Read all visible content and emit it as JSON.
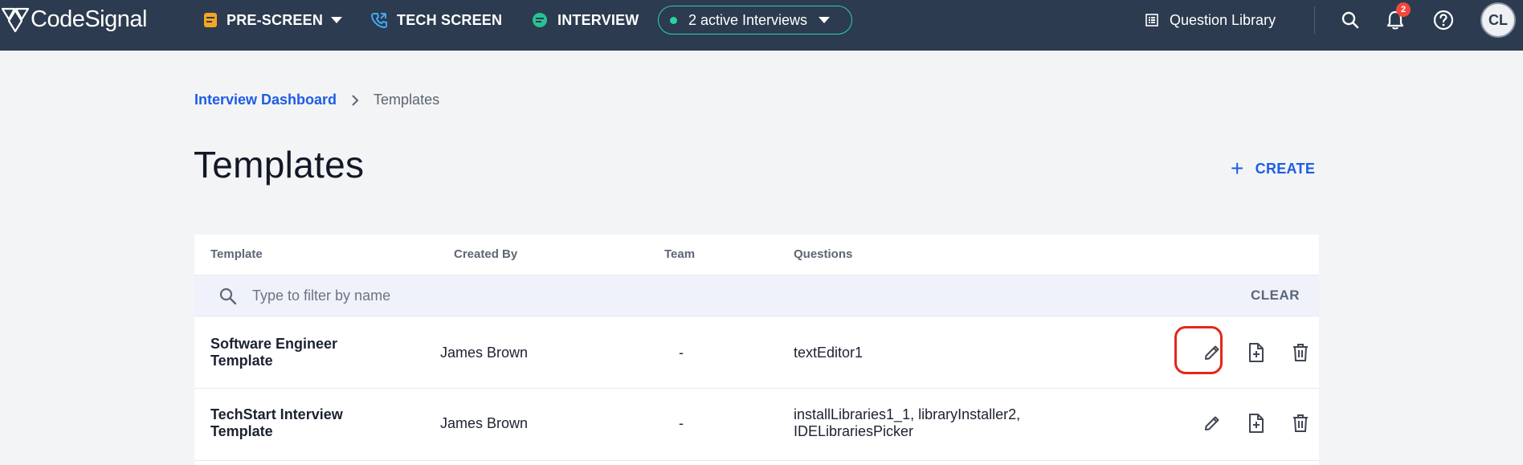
{
  "app": {
    "brand": "CodeSignal"
  },
  "nav": {
    "pre_screen": "PRE-SCREEN",
    "tech_screen": "TECH SCREEN",
    "interview": "INTERVIEW",
    "active_interviews": "2 active Interviews",
    "question_library": "Question Library",
    "notifications_count": "2",
    "avatar_initials": "CL"
  },
  "breadcrumb": {
    "parent": "Interview Dashboard",
    "current": "Templates"
  },
  "page": {
    "title": "Templates",
    "create_label": "CREATE"
  },
  "table": {
    "columns": {
      "template": "Template",
      "created_by": "Created By",
      "team": "Team",
      "questions": "Questions"
    },
    "filter": {
      "placeholder": "Type to filter by name",
      "clear_label": "CLEAR"
    },
    "rows": [
      {
        "name_line1": "Software Engineer",
        "name_line2": "Template",
        "created_by": "James Brown",
        "team": "-",
        "q_line1": "textEditor1",
        "q_line2": ""
      },
      {
        "name_line1": "TechStart Interview",
        "name_line2": "Template",
        "created_by": "James Brown",
        "team": "-",
        "q_line1": "installLibraries1_1, libraryInstaller2,",
        "q_line2": "IDELibrariesPicker"
      }
    ]
  },
  "colors": {
    "nav_bg": "#2c3b4f",
    "accent": "#1d5ce6",
    "pill_border": "#2fd1a6",
    "highlight": "#e5261b"
  },
  "icons": [
    "codesignal-logo-icon",
    "pre-screen-icon",
    "tech-screen-icon",
    "interview-icon",
    "question-library-icon",
    "search-icon",
    "bell-icon",
    "help-icon",
    "chevron-right-icon",
    "plus-icon",
    "pencil-icon",
    "file-plus-icon",
    "trash-icon"
  ]
}
